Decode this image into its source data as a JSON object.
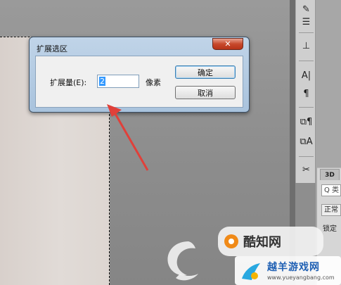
{
  "dialog": {
    "title": "扩展选区",
    "close_glyph": "✕",
    "expand_label": "扩展量(E):",
    "expand_value": "2",
    "unit": "像素",
    "ok_label": "确定",
    "cancel_label": "取消"
  },
  "panel": {
    "tab_3d": "3D",
    "search_text": "Q 类",
    "blend_mode": "正常",
    "lock_label": "锁定"
  },
  "tools": [
    {
      "name": "brush-tool-icon",
      "glyph": "✎"
    },
    {
      "name": "adjust-sliders-icon",
      "glyph": "☰"
    },
    {
      "name": "clone-stamp-icon",
      "glyph": "⊥"
    },
    {
      "name": "character-panel-icon",
      "glyph": "A|"
    },
    {
      "name": "paragraph-panel-icon",
      "glyph": "¶"
    },
    {
      "name": "paragraph-styles-icon",
      "glyph": "⧉¶"
    },
    {
      "name": "character-styles-icon",
      "glyph": "⧉A"
    },
    {
      "name": "tool-presets-icon",
      "glyph": "✂"
    }
  ],
  "watermark": {
    "logo_text": "酷知网",
    "site_text": "越羊游戏网",
    "url_text": "www.yueyangbang.com"
  },
  "colors": {
    "arrow": "#e0403a",
    "selection_highlight": "#3399ff",
    "close_button": "#c8492c"
  }
}
